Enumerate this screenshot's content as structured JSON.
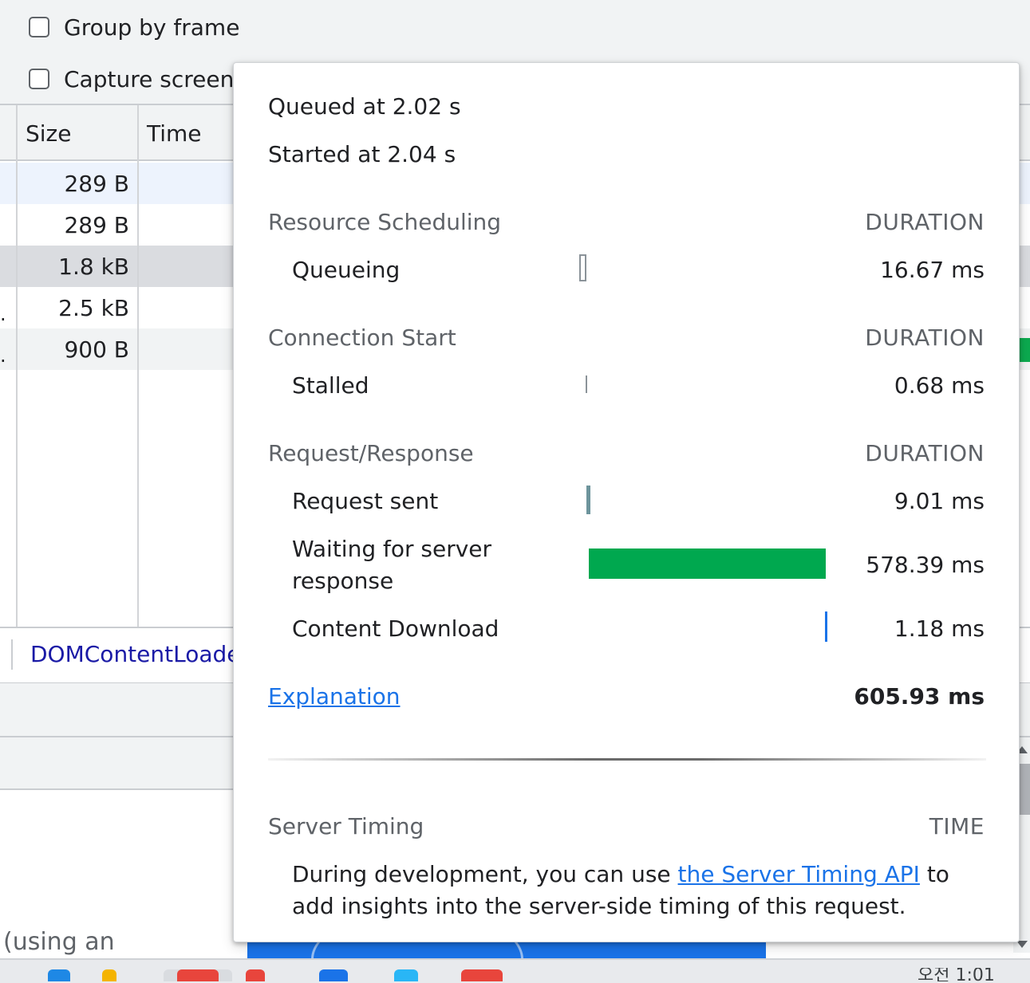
{
  "toolbar": {
    "group_by_frame_label": "Group by frame",
    "capture_screenshots_label": "Capture screens"
  },
  "table": {
    "columns": [
      "Size",
      "Time"
    ],
    "rows": [
      {
        "size": "289 B"
      },
      {
        "size": "289 B"
      },
      {
        "size": "1.8 kB"
      },
      {
        "size": "2.5 kB"
      },
      {
        "size": "900 B"
      }
    ]
  },
  "status_bar": {
    "domcontentloaded": "DOMContentLoade"
  },
  "lower_text": "(using an",
  "taskbar": {
    "clock": "오전 1:01"
  },
  "timing": {
    "queued": "Queued at 2.02 s",
    "started": "Started at 2.04 s",
    "duration_header": "DURATION",
    "sections": [
      {
        "title": "Resource Scheduling",
        "phases": [
          {
            "label": "Queueing",
            "value": "16.67 ms"
          }
        ]
      },
      {
        "title": "Connection Start",
        "phases": [
          {
            "label": "Stalled",
            "value": "0.68 ms"
          }
        ]
      },
      {
        "title": "Request/Response",
        "phases": [
          {
            "label": "Request sent",
            "value": "9.01 ms"
          },
          {
            "label": "Waiting for server response",
            "value": "578.39 ms"
          },
          {
            "label": "Content Download",
            "value": "1.18 ms"
          }
        ]
      }
    ],
    "explanation_link": "Explanation",
    "total": "605.93 ms",
    "server_timing": {
      "title": "Server Timing",
      "time_header": "TIME",
      "desc_before": "During development, you can use ",
      "link": "the Server Timing API",
      "desc_after": " to add insights into the server-side timing of this request."
    }
  },
  "colors": {
    "waiting_bar": "#00a84f",
    "download_bar": "#1a73e8",
    "request_sent_bar": "#6d949c",
    "link": "#1a73e8"
  }
}
